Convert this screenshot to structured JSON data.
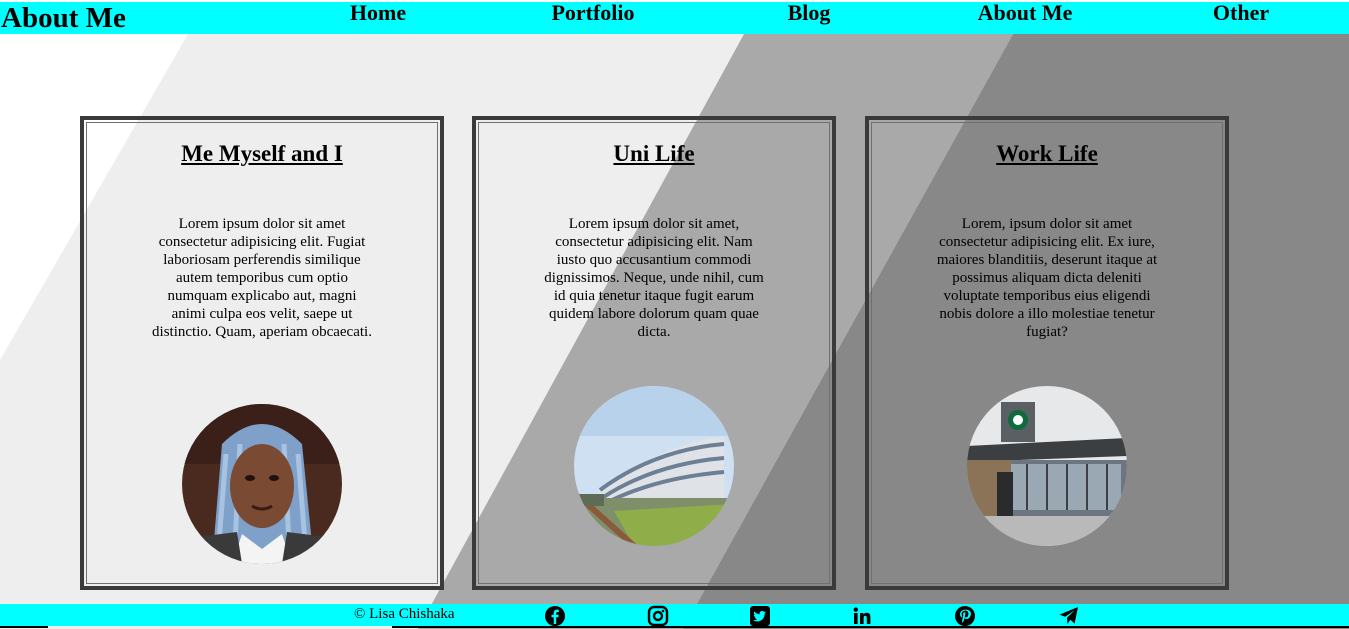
{
  "header": {
    "brand": "About Me",
    "nav": [
      "Home",
      "Portfolio",
      "Blog",
      "About Me",
      "Other"
    ]
  },
  "cards": [
    {
      "title": "Me Myself and I",
      "text": "Lorem ipsum dolor sit amet consectetur adipisicing elit. Fugiat laboriosam perferendis similique autem temporibus cum optio numquam explicabo aut, magni animi culpa eos velit, saepe ut distinctio. Quam, aperiam obcaecati."
    },
    {
      "title": "Uni Life",
      "text": "Lorem ipsum dolor sit amet, consectetur adipisicing elit. Nam iusto quo accusantium commodi dignissimos. Neque, unde nihil, cum id quia tenetur itaque fugit earum quidem labore dolorum quam quae dicta."
    },
    {
      "title": "Work Life",
      "text": "Lorem, ipsum dolor sit amet consectetur adipisicing elit. Ex iure, maiores blanditiis, deserunt itaque at possimus aliquam dicta deleniti voluptate temporibus eius eligendi nobis dolore a illo molestiae tenetur fugiat?"
    }
  ],
  "footer": {
    "copyright": "© Lisa Chishaka",
    "social_icons": [
      "facebook-icon",
      "instagram-icon",
      "twitter-icon",
      "linkedin-icon",
      "pinterest-icon",
      "telegram-icon"
    ]
  },
  "colors": {
    "header_bg": "#00ffff",
    "footer_bg": "#00ffff",
    "band_light": "#eeeeef",
    "band_mid": "#a9a9a9",
    "band_dark": "#888888"
  }
}
